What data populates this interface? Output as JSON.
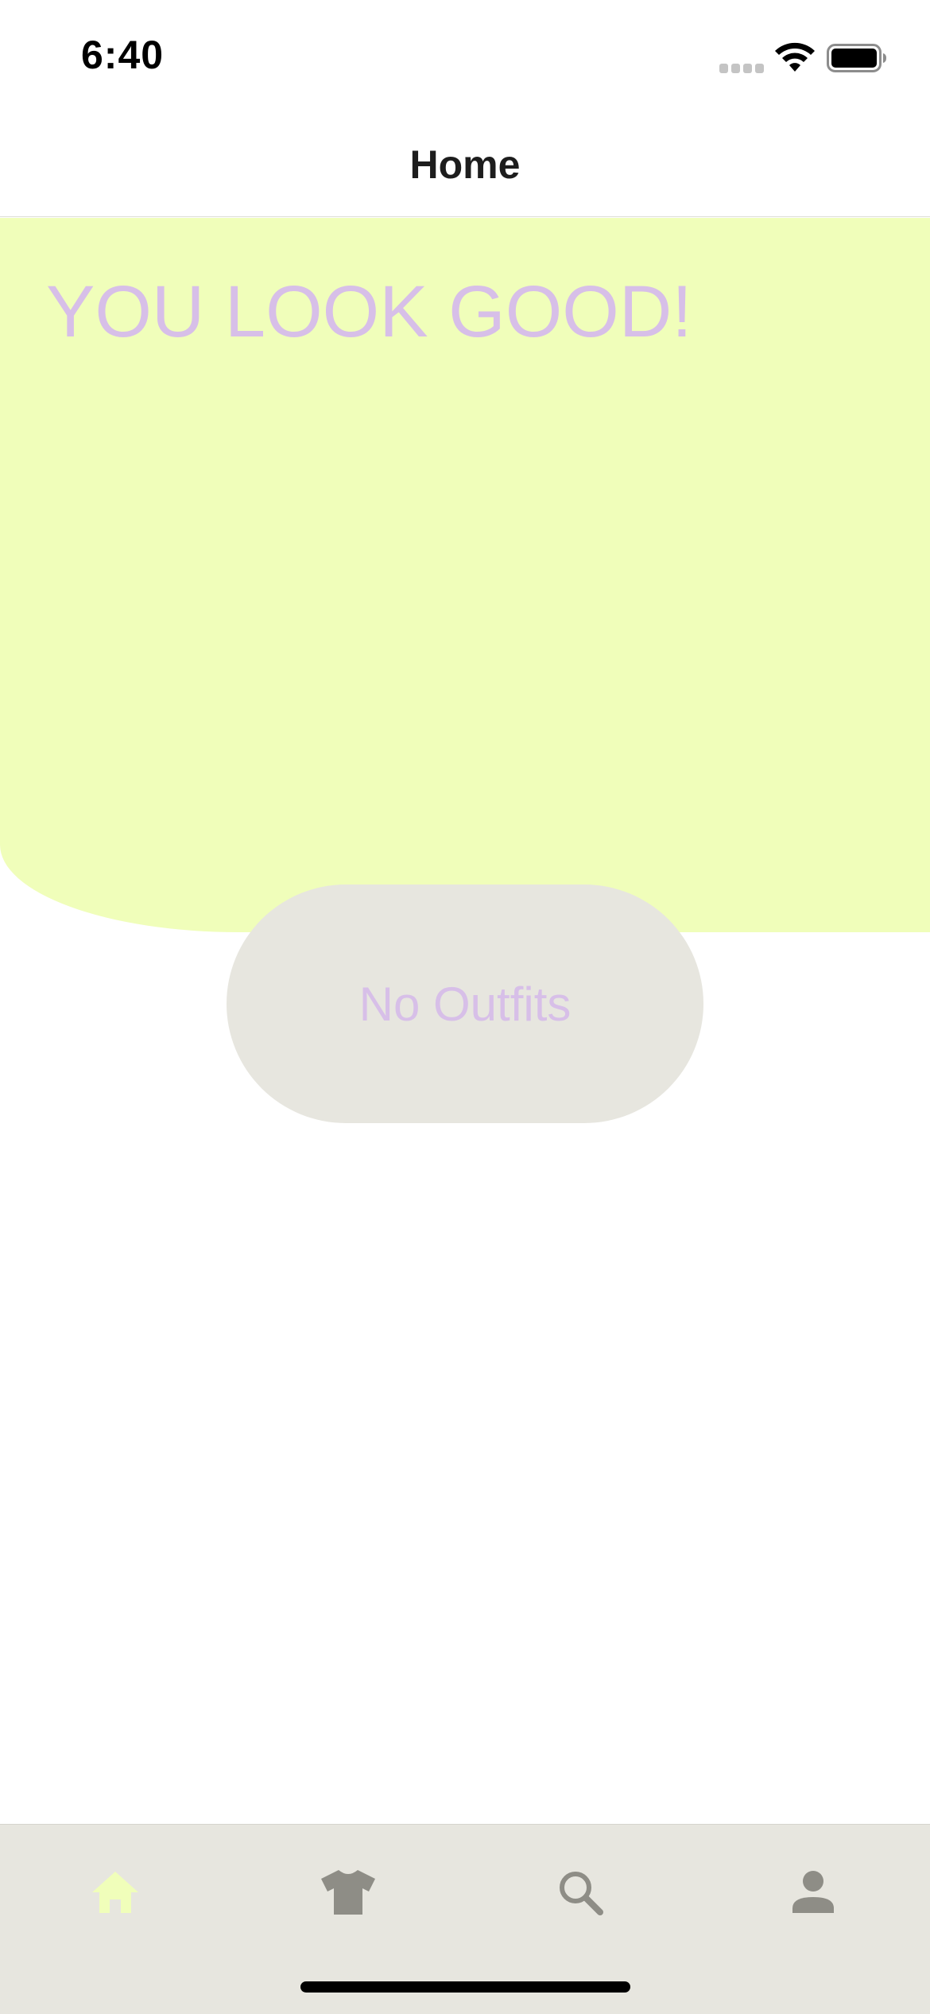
{
  "status_bar": {
    "time": "6:40",
    "icons": [
      "cellular-signal-icon",
      "wifi-icon",
      "battery-icon"
    ]
  },
  "nav": {
    "title": "Home"
  },
  "hero": {
    "title": "YOU LOOK GOOD!"
  },
  "outfits": {
    "label": "No Outfits"
  },
  "tab_bar": {
    "items": [
      {
        "icon": "home-icon",
        "active": true
      },
      {
        "icon": "shirt-icon",
        "active": false
      },
      {
        "icon": "search-icon",
        "active": false
      },
      {
        "icon": "person-icon",
        "active": false
      }
    ]
  },
  "colors": {
    "hero_background": "#f0feba",
    "accent_lilac": "#d7bfe8",
    "pill_background": "#e7e6df",
    "tab_bar_background": "#e7e6df",
    "tab_active": "#f0feba",
    "tab_inactive": "#8e8d86"
  }
}
